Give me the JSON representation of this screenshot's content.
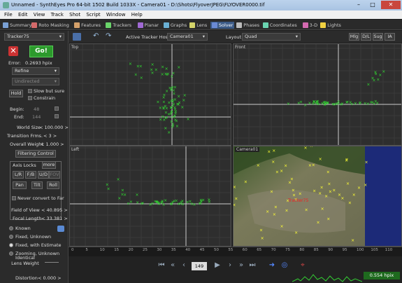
{
  "window": {
    "title": "Unnamed - SynthEyes Pro 64-bit 1502 Build 1033X - Camera01 - D:\\Shots\\FlyoverJPEG\\FLYOVER0000.tif",
    "minimize": "–",
    "maximize": "□",
    "close": "✕"
  },
  "menu": [
    "File",
    "Edit",
    "View",
    "Track",
    "Shot",
    "Script",
    "Window",
    "Help"
  ],
  "rooms": [
    {
      "label": "Summary",
      "color": "#7aa0d4",
      "selected": false
    },
    {
      "label": "Roto Masking",
      "color": "#d46a6a",
      "selected": false
    },
    {
      "label": "Features",
      "color": "#d4a06a",
      "selected": false
    },
    {
      "label": "Trackers",
      "color": "#6ad46a",
      "selected": false
    },
    {
      "label": "Planar",
      "color": "#a06ad4",
      "selected": false
    },
    {
      "label": "Graphs",
      "color": "#6ab0d4",
      "selected": false
    },
    {
      "label": "Lens",
      "color": "#d4d46a",
      "selected": false
    },
    {
      "label": "Solver",
      "color": "#6a8ad4",
      "selected": true
    },
    {
      "label": "Phases",
      "color": "#bbbbbb",
      "selected": false
    },
    {
      "label": "Coordinates",
      "color": "#6ad4b0",
      "selected": false
    },
    {
      "label": "3-D",
      "color": "#d46ab0",
      "selected": false
    },
    {
      "label": "Lights",
      "color": "#f0d040",
      "selected": false
    }
  ],
  "toolbar": {
    "active_tracker_host_label": "Active Tracker Host:",
    "active_tracker_host": "Camera01",
    "layout_label": "Layout:",
    "layout": "Quad",
    "right_buttons": [
      "Mlg",
      "D/L",
      "Sug",
      "IA"
    ]
  },
  "solver": {
    "tracker": "Tracker75",
    "go_label": "Go!",
    "error_label": "Error:",
    "error_value": "0.2693 hpix",
    "mode": "Refine",
    "direction": "Undirected",
    "hold_label": "Hold",
    "slow_label": "Slow but sure",
    "constrain_label": "Constrain",
    "begin_label": "Begin:",
    "begin_value": "48",
    "end_label": "End:",
    "end_value": "144",
    "world_size_label": "World Size",
    "world_size_value": "< 100.000 >",
    "transition_label": "Transition Frms.",
    "transition_value": "< 3 >",
    "overall_weight_label": "Overall Weight",
    "overall_weight_value": "< 1.000 >",
    "filtering_label": "Filtering Control",
    "axis_locks_label": "Axis Locks",
    "more_label": "more",
    "axis_buttons": [
      "L/R",
      "F/B",
      "U/D",
      "FOV",
      "Pan",
      "Tilt",
      "Roll"
    ],
    "never_convert_label": "Never convert to Far",
    "fov_label": "Field of View",
    "fov_value": "< 40.895 >",
    "focal_label": "Focal Length",
    "focal_value": "< 33.381 >",
    "lens_modes": [
      {
        "label": "Known",
        "on": false
      },
      {
        "label": "Fixed, Unknown",
        "on": false
      },
      {
        "label": "Fixed, with Estimate",
        "on": true
      },
      {
        "label": "Zooming, Unknown",
        "on": false
      }
    ],
    "identical_lens_label": "Identical Lens Weight",
    "distortion_label": "Distortion",
    "distortion_value": "< 0.000 >"
  },
  "viewports": {
    "top": "Top",
    "front": "Front",
    "left": "Left",
    "camera": "Camera01",
    "camera_tracker": "Tracker75"
  },
  "timeline": {
    "ticks": [
      "0",
      "5",
      "10",
      "15",
      "20",
      "25",
      "30",
      "35",
      "40",
      "45",
      "50",
      "55",
      "60",
      "65",
      "70",
      "75",
      "80",
      "85",
      "90",
      "95",
      "100",
      "105",
      "110"
    ]
  },
  "transport": {
    "frame": "149",
    "hpix": "0.554 hpix"
  },
  "colors": {
    "tracker": "#33dd33",
    "marker": "#ffff33",
    "accent": "#3b5a86"
  }
}
